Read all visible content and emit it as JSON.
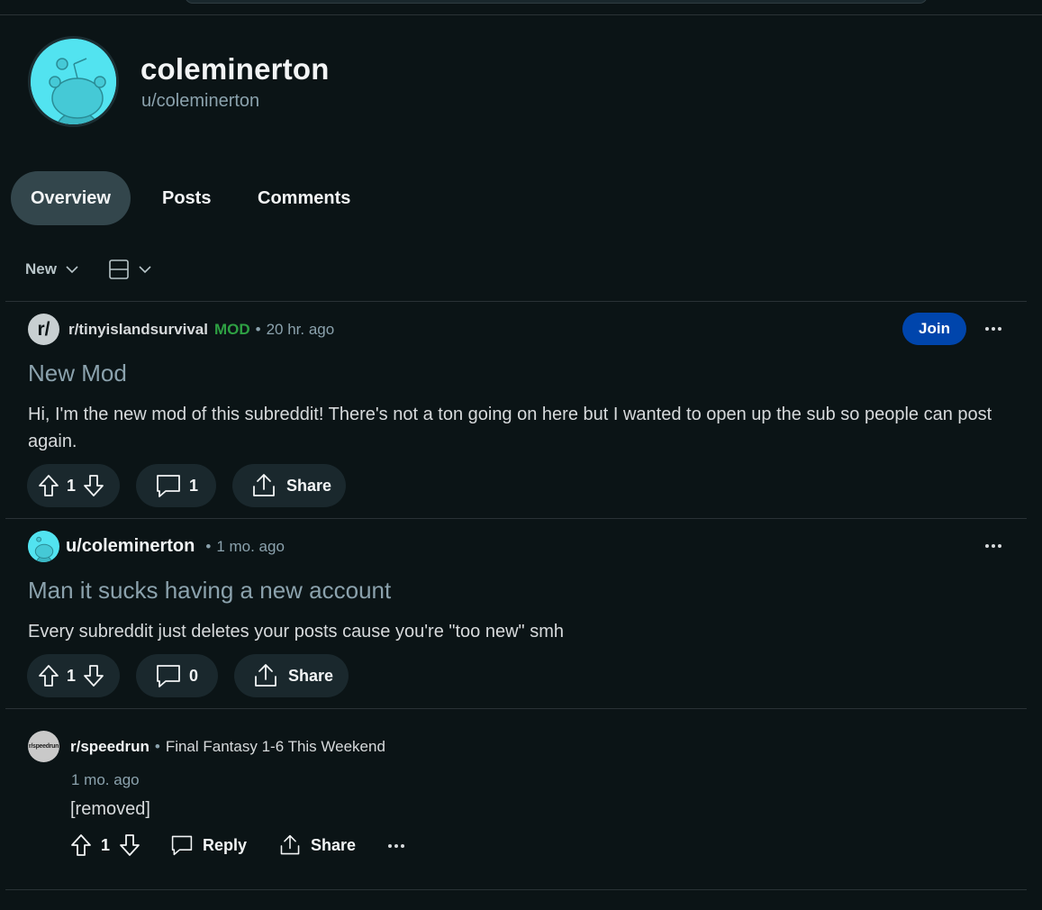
{
  "profile": {
    "display_name": "coleminerton",
    "username": "u/coleminerton"
  },
  "tabs": [
    {
      "label": "Overview",
      "active": true
    },
    {
      "label": "Posts",
      "active": false
    },
    {
      "label": "Comments",
      "active": false
    }
  ],
  "sort": {
    "label": "New"
  },
  "posts": [
    {
      "subreddit_icon_text": "r/",
      "subreddit": "r/tinyislandsurvival",
      "mod_badge": "MOD",
      "separator": "•",
      "time": "20 hr. ago",
      "join_label": "Join",
      "title": "New Mod",
      "body": "Hi, I'm the new mod of this subreddit! There's not a ton going on here but I wanted to open up the sub so people can post again.",
      "votes": "1",
      "comments": "1",
      "share_label": "Share"
    },
    {
      "author": "u/coleminerton",
      "separator": "•",
      "time": "1 mo. ago",
      "title": "Man it sucks having a new account",
      "body": "Every subreddit just deletes your posts cause you're \"too new\" smh",
      "votes": "1",
      "comments": "0",
      "share_label": "Share"
    }
  ],
  "comment": {
    "subreddit_icon_text": "r/speedrun",
    "subreddit": "r/speedrun",
    "separator": "•",
    "post_title": "Final Fantasy 1-6 This Weekend",
    "time": "1 mo. ago",
    "text": "[removed]",
    "votes": "1",
    "reply_label": "Reply",
    "share_label": "Share"
  },
  "colors": {
    "background": "#0b1416",
    "accent_join": "#0045ac",
    "mod_green": "#2ea043",
    "pill_bg": "#1a282d",
    "avatar_cyan": "#52e3f0"
  }
}
